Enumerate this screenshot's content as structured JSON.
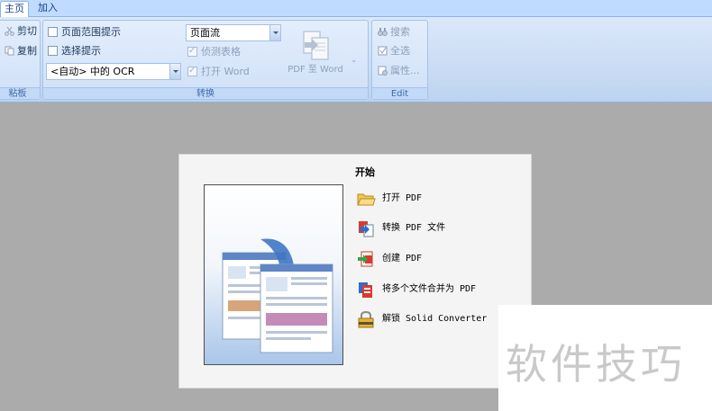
{
  "tabs": [
    {
      "label": "主页",
      "active": true
    },
    {
      "label": "加入",
      "active": false
    }
  ],
  "clipboard": {
    "cut_label": "剪切",
    "copy_label": "复制",
    "group_label": "粘板"
  },
  "convert": {
    "page_range_hint": "页面范围提示",
    "select_hint": "选择提示",
    "ocr_combo": "<自动> 中的 OCR",
    "mode_combo": "页面流",
    "detect_tables": "侦测表格",
    "open_word": "打开 Word",
    "pdf_to_word": "PDF 至 Word",
    "dropdown_glyph": "⌄",
    "group_label": "转换"
  },
  "edit": {
    "search_label": "搜索",
    "select_all_label": "全选",
    "properties_label": "属性...",
    "group_label": "Edit"
  },
  "start_panel": {
    "title": "开始",
    "actions": [
      {
        "label": "打开 PDF",
        "icon": "folder-icon"
      },
      {
        "label": "转换 PDF 文件",
        "icon": "convert-icon"
      },
      {
        "label": "创建 PDF",
        "icon": "create-pdf-icon"
      },
      {
        "label": "将多个文件合并为 PDF",
        "icon": "merge-icon"
      },
      {
        "label": "解锁 Solid Converter",
        "icon": "lock-icon"
      }
    ]
  },
  "watermark": "软件技巧",
  "colors": {
    "ribbon_bg": "#c7daf3",
    "workspace_bg": "#ababab",
    "tab_text": "#15428b"
  }
}
